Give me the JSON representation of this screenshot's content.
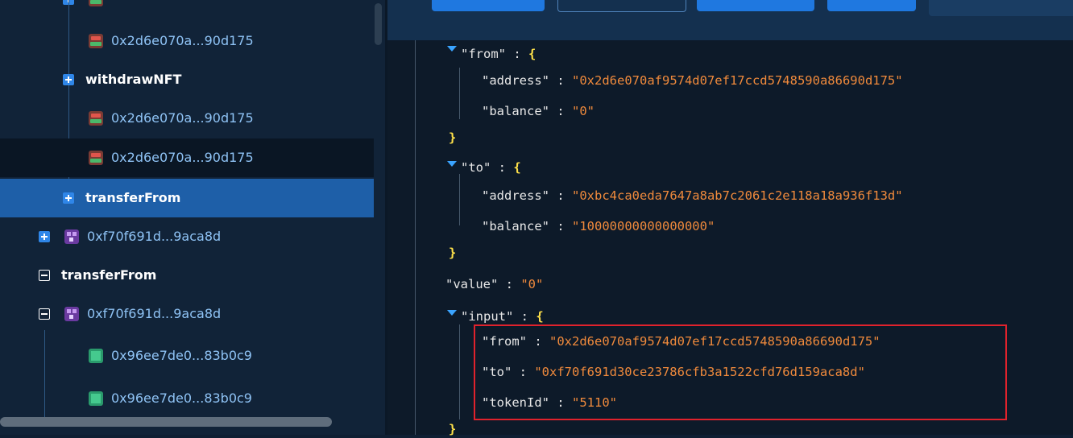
{
  "tree": {
    "rows": [
      {
        "kind": "addr",
        "label": "0x2d6e070a...90d175",
        "avatar": "red"
      },
      {
        "kind": "fn",
        "label": "withdrawNFT",
        "toggle": "plus"
      },
      {
        "kind": "addr",
        "label": "0x2d6e070a...90d175",
        "avatar": "red"
      },
      {
        "kind": "addr",
        "label": "0x2d6e070a...90d175",
        "avatar": "red"
      },
      {
        "kind": "fn",
        "label": "transferFrom",
        "toggle": "plus"
      },
      {
        "kind": "addr",
        "label": "0xf70f691d...9aca8d",
        "avatar": "purple",
        "toggle": "plus"
      },
      {
        "kind": "fn",
        "label": "transferFrom",
        "toggle": "minus"
      },
      {
        "kind": "addr",
        "label": "0xf70f691d...9aca8d",
        "avatar": "purple",
        "toggle": "minus"
      },
      {
        "kind": "addr",
        "label": "0x96ee7de0...83b0c9",
        "avatar": "green"
      },
      {
        "kind": "addr",
        "label": "0x96ee7de0...83b0c9",
        "avatar": "green"
      }
    ]
  },
  "json": {
    "from_key": "\"from\"",
    "from_address_key": "\"address\"",
    "from_address_value": "\"0x2d6e070af9574d07ef17ccd5748590a86690d175\"",
    "from_balance_key": "\"balance\"",
    "from_balance_value": "\"0\"",
    "to_key": "\"to\"",
    "to_address_key": "\"address\"",
    "to_address_value": "\"0xbc4ca0eda7647a8ab7c2061c2e118a18a936f13d\"",
    "to_balance_key": "\"balance\"",
    "to_balance_value": "\"10000000000000000\"",
    "value_key": "\"value\"",
    "value_value": "\"0\"",
    "input_key": "\"input\"",
    "input_from_key": "\"from\"",
    "input_from_value": "\"0x2d6e070af9574d07ef17ccd5748590a86690d175\"",
    "input_to_key": "\"to\"",
    "input_to_value": "\"0xf70f691d30ce23786cfb3a1522cfd76d159aca8d\"",
    "input_tokenid_key": "\"tokenId\"",
    "input_tokenid_value": "\"5110\"",
    "colon": " : ",
    "open_brace": "{",
    "close_brace": "}"
  },
  "colors": {
    "selected_row": "#1e5fa8",
    "json_key": "#e8e8e8",
    "json_string": "#f08a3c",
    "json_brace": "#ffe24a",
    "highlight_box": "#e0222c"
  }
}
